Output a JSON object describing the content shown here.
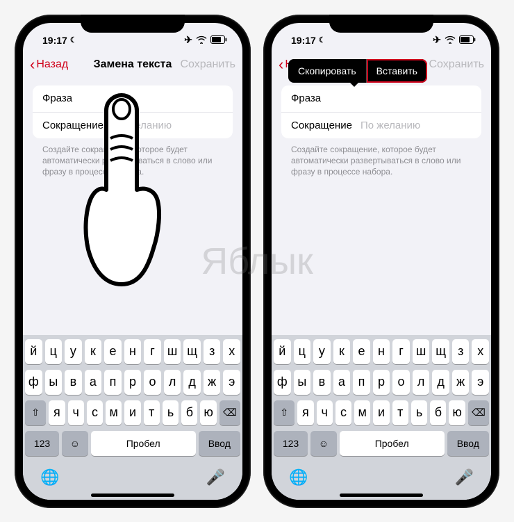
{
  "watermark": "Яблык",
  "status": {
    "time": "19:17",
    "moon": "☾",
    "airplane": "✈",
    "wifi": "wifi",
    "battery": "battery"
  },
  "nav": {
    "back": "Назад",
    "title": "Замена текста",
    "save": "Сохранить"
  },
  "form": {
    "phrase_label": "Фраза",
    "shortcut_label": "Сокращение",
    "shortcut_placeholder": "По желанию",
    "footer": "Создайте сокращение, которое будет автоматически развертываться в слово или фразу в процессе набора."
  },
  "context_menu": {
    "copy": "Скопировать",
    "paste": "Вставить"
  },
  "keyboard": {
    "row1": [
      "й",
      "ц",
      "у",
      "к",
      "е",
      "н",
      "г",
      "ш",
      "щ",
      "з",
      "х"
    ],
    "row2": [
      "ф",
      "ы",
      "в",
      "а",
      "п",
      "р",
      "о",
      "л",
      "д",
      "ж",
      "э"
    ],
    "row3": [
      "я",
      "ч",
      "с",
      "м",
      "и",
      "т",
      "ь",
      "б",
      "ю"
    ],
    "num": "123",
    "space": "Пробел",
    "enter": "Ввод",
    "shift": "⇧",
    "backspace": "⌫",
    "emoji": "☺",
    "globe": "🌐",
    "mic": "🎤"
  }
}
